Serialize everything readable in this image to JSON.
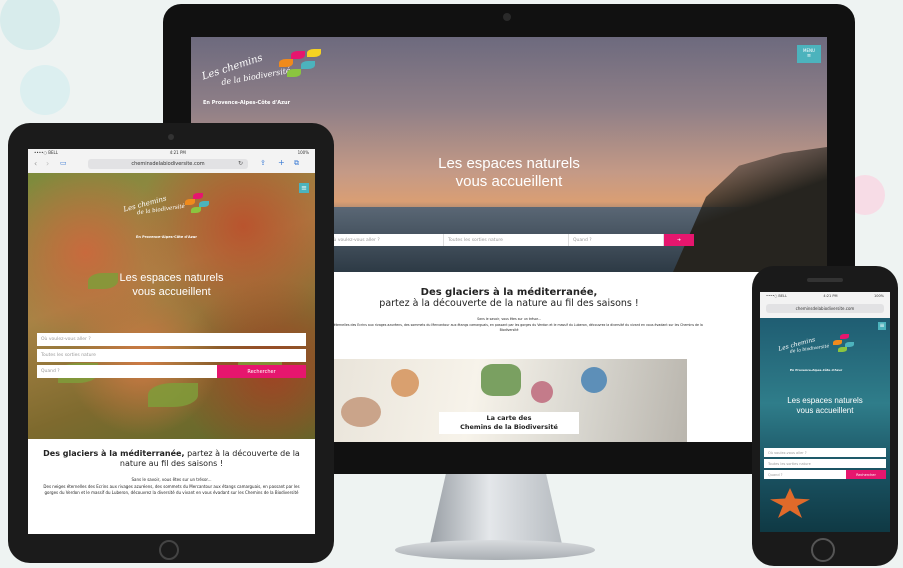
{
  "brand": {
    "logo_line1": "Les chemins",
    "logo_line2": "de la biodiversité",
    "region": "En Provence-Alpes-Côte d'Azur",
    "accent_color": "#e6166e",
    "menu_color": "#4cb3bd"
  },
  "menu_label": "MENU",
  "hero": {
    "title_line1": "Les espaces naturels",
    "title_line2": "vous accueillent"
  },
  "search": {
    "where_placeholder": "Où voulez-vous aller ?",
    "nature_placeholder": "Toutes les sorties nature",
    "when_placeholder": "Quand ?",
    "button_label": "Rechercher"
  },
  "section": {
    "title_bold": "Des glaciers à la méditerranée,",
    "title_rest": "partez à la découverte de la nature au fil des saisons !",
    "intro": "Sans le savoir, vous êtes sur un trésor...",
    "body": "Des neiges éternelles des Ecrins aux rivages azuréens, des sommets du Mercantour aux étangs camarguais, en passant par les gorges du Verdon et le massif du Luberon, découvrez la diversité du vivant en vous évadant sur les Chemins de la Biodiversité"
  },
  "map_card": {
    "line1": "La carte des",
    "line2": "Chemins de la Biodiversité"
  },
  "browser": {
    "url": "cheminsdelabiodiversite.com",
    "carrier": "••••○ BELL",
    "time": "4:21 PM",
    "battery": "100%"
  }
}
